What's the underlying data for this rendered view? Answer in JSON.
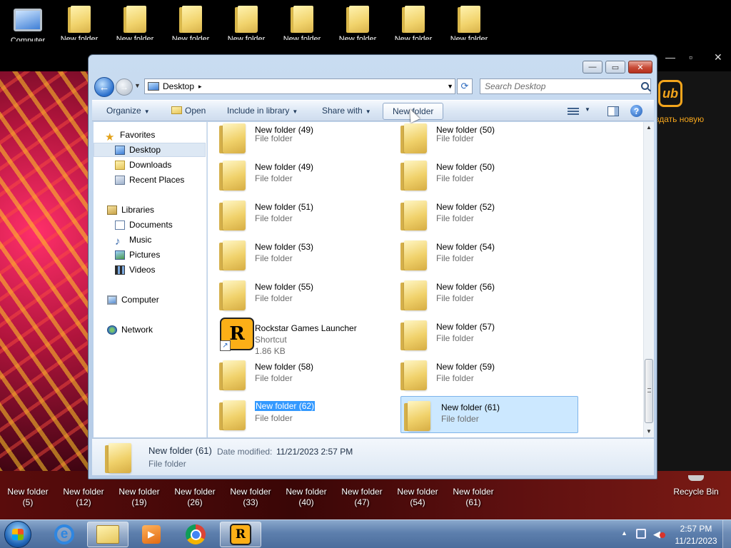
{
  "desktop": {
    "top_icons": [
      {
        "label": "Computer"
      },
      {
        "label": "New folder"
      },
      {
        "label": "New folder"
      },
      {
        "label": "New folder"
      },
      {
        "label": "New folder"
      },
      {
        "label": "New folder"
      },
      {
        "label": "New folder"
      },
      {
        "label": "New folder"
      },
      {
        "label": "New folder"
      }
    ],
    "bottom_icons": [
      {
        "name": "New folder",
        "num": "(5)"
      },
      {
        "name": "New folder",
        "num": "(12)"
      },
      {
        "name": "New folder",
        "num": "(19)"
      },
      {
        "name": "New folder",
        "num": "(26)"
      },
      {
        "name": "New folder",
        "num": "(33)"
      },
      {
        "name": "New folder",
        "num": "(40)"
      },
      {
        "name": "New folder",
        "num": "(47)"
      },
      {
        "name": "New folder",
        "num": "(54)"
      },
      {
        "name": "New folder",
        "num": "(61)"
      }
    ],
    "recycle_bin": "Recycle Bin",
    "background_app": {
      "logo_text": "ub",
      "caption": "здать новую"
    }
  },
  "window": {
    "title_buttons": {
      "minimize": "—",
      "maximize": "▭",
      "close": "✕"
    },
    "address": {
      "location": "Desktop",
      "separator": "▸"
    },
    "search": {
      "placeholder": "Search Desktop"
    },
    "toolbar": {
      "organize": "Organize",
      "open": "Open",
      "include_in_library": "Include in library",
      "share_with": "Share with",
      "new_folder": "New folder"
    },
    "nav": {
      "favorites": "Favorites",
      "desktop": "Desktop",
      "downloads": "Downloads",
      "recent_places": "Recent Places",
      "libraries": "Libraries",
      "documents": "Documents",
      "music": "Music",
      "pictures": "Pictures",
      "videos": "Videos",
      "computer": "Computer",
      "network": "Network"
    },
    "files": [
      {
        "name": "New folder (49)",
        "type": "File folder"
      },
      {
        "name": "New folder (50)",
        "type": "File folder"
      },
      {
        "name": "New folder (49)",
        "type": "File folder"
      },
      {
        "name": "New folder (50)",
        "type": "File folder"
      },
      {
        "name": "New folder (51)",
        "type": "File folder"
      },
      {
        "name": "New folder (52)",
        "type": "File folder"
      },
      {
        "name": "New folder (53)",
        "type": "File folder"
      },
      {
        "name": "New folder (54)",
        "type": "File folder"
      },
      {
        "name": "New folder (55)",
        "type": "File folder"
      },
      {
        "name": "New folder (56)",
        "type": "File folder"
      },
      {
        "name": "Rockstar Games Launcher",
        "type": "Shortcut",
        "size": "1.86 KB"
      },
      {
        "name": "New folder (57)",
        "type": "File folder"
      },
      {
        "name": "New folder (58)",
        "type": "File folder"
      },
      {
        "name": "New folder (59)",
        "type": "File folder"
      },
      {
        "name": "New folder (62)",
        "type": "File folder"
      },
      {
        "name": "New folder (61)",
        "type": "File folder"
      }
    ],
    "details": {
      "name": "New folder (61)",
      "date_label": "Date modified:",
      "date_value": "11/21/2023 2:57 PM",
      "type": "File folder"
    }
  },
  "taskbar": {
    "time": "2:57 PM",
    "date": "11/21/2023"
  }
}
